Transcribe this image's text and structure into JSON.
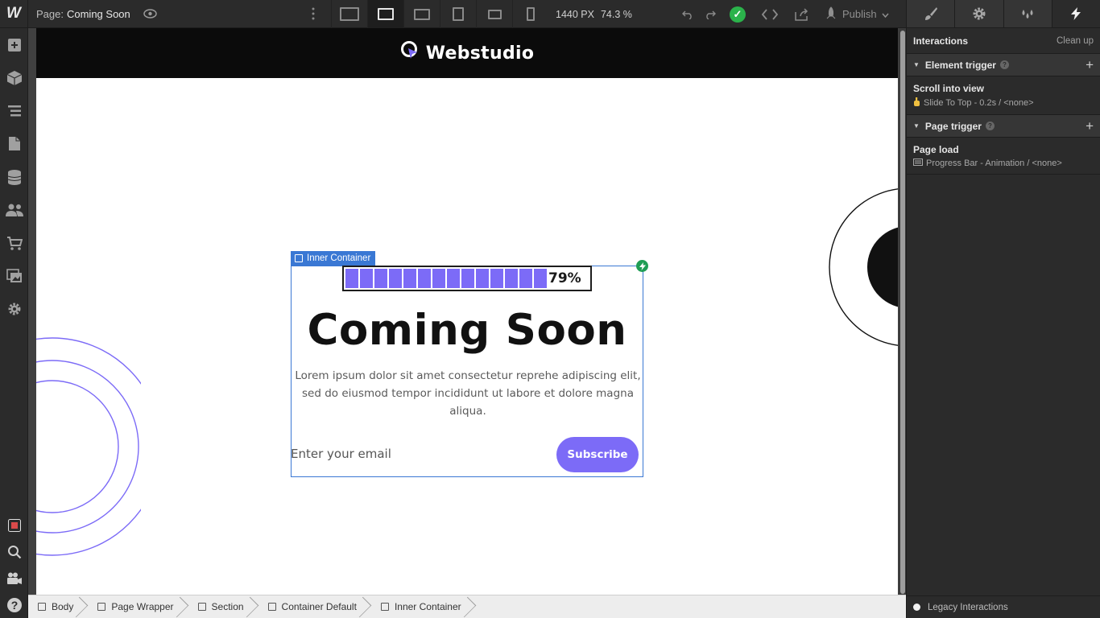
{
  "app": {
    "logo": "W"
  },
  "topbar": {
    "page_label": "Page:",
    "page_name": "Coming Soon",
    "canvas_width": "1440 PX",
    "zoom": "74.3 %",
    "publish_label": "Publish"
  },
  "right_panel": {
    "tabs": [
      "style-brush-icon",
      "settings-gear-icon",
      "drops-icon",
      "bolt-icon"
    ],
    "interactions_title": "Interactions",
    "clean_up": "Clean up",
    "element_trigger": {
      "label": "Element trigger",
      "entry_name": "Scroll into view",
      "entry_desc": "Slide To Top - 0.2s / <none>"
    },
    "page_trigger": {
      "label": "Page trigger",
      "entry_name": "Page load",
      "entry_desc": "Progress Bar - Animation / <none>"
    },
    "legacy": "Legacy Interactions"
  },
  "canvas": {
    "brand": "Webstudio",
    "selected_label": "Inner Container",
    "progress": 0.79,
    "progress_text": "79%",
    "progress_segments": 14,
    "title": "Coming Soon",
    "description": "Lorem ipsum dolor sit amet consectetur reprehe adipiscing elit, sed do eiusmod tempor incididunt ut labore et dolore magna aliqua.",
    "email_placeholder": "Enter your email",
    "subscribe_label": "Subscribe",
    "accent": "#7c6bf7",
    "selection_color": "#3a78d4"
  },
  "breadcrumbs": [
    "Body",
    "Page Wrapper",
    "Section",
    "Container Default",
    "Inner Container"
  ]
}
